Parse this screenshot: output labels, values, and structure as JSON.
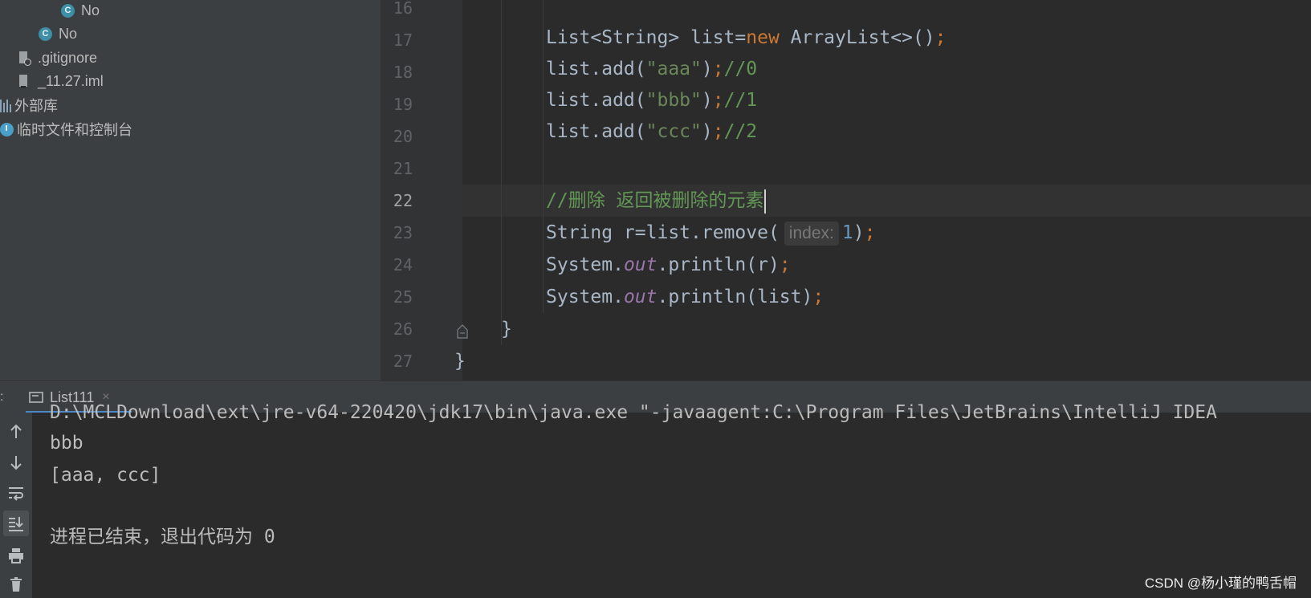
{
  "project_tree": {
    "items": [
      {
        "label": "No",
        "icon": "class-icon"
      },
      {
        "label": "No",
        "icon": "class-icon"
      },
      {
        "label": ".gitignore",
        "icon": "ignored-file-icon"
      },
      {
        "label": "_11.27.iml",
        "icon": "module-file-icon"
      },
      {
        "label": "外部库",
        "icon": "library-icon"
      },
      {
        "label": "临时文件和控制台",
        "icon": "scratch-icon"
      }
    ]
  },
  "editor": {
    "line_numbers": [
      "16",
      "17",
      "18",
      "19",
      "20",
      "21",
      "22",
      "23",
      "24",
      "25",
      "26",
      "27"
    ],
    "current_line": "22",
    "code": {
      "l17": {
        "t1": "List<String> list=",
        "kw_new": "new",
        "t2": " ArrayList<>()",
        "semi": ";"
      },
      "l18": {
        "t1": "list.add(",
        "str": "\"aaa\"",
        "t2": ")",
        "semi": ";",
        "comment": "//0"
      },
      "l19": {
        "t1": "list.add(",
        "str": "\"bbb\"",
        "t2": ")",
        "semi": ";",
        "comment": "//1"
      },
      "l20": {
        "t1": "list.add(",
        "str": "\"ccc\"",
        "t2": ")",
        "semi": ";",
        "comment": "//2"
      },
      "l22": {
        "comment": "//删除 返回被删除的元素"
      },
      "l23": {
        "t1": "String r=list.remove(",
        "hint_name": "index:",
        "hint_value": "1",
        "t2": ")",
        "semi": ";"
      },
      "l24": {
        "t1": "System.",
        "field": "out",
        "t2": ".println(r)",
        "semi": ";"
      },
      "l25": {
        "t1": "System.",
        "field": "out",
        "t2": ".println(list)",
        "semi": ";"
      },
      "l26": {
        "t1": "}"
      },
      "l27": {
        "t1": "}"
      }
    }
  },
  "run_panel": {
    "tab_prefix": ":",
    "tab_label": "List111",
    "tab_close": "×",
    "toolbar": [
      "up-arrow-icon",
      "down-arrow-icon",
      "soft-wrap-icon",
      "scroll-to-end-icon",
      "print-icon",
      "trash-icon"
    ],
    "console_lines": [
      "D:\\MCLDownload\\ext\\jre-v64-220420\\jdk17\\bin\\java.exe \"-javaagent:C:\\Program Files\\JetBrains\\IntelliJ IDEA",
      "bbb",
      "[aaa, ccc]",
      "",
      "进程已结束，退出代码为 0"
    ]
  },
  "watermark": "CSDN @杨小瑾的鸭舌帽",
  "colors": {
    "keyword": "#cc7832",
    "string": "#6a8759",
    "comment": "#629755",
    "number": "#6897bb",
    "field": "#9876aa",
    "accent": "#4a88c7"
  }
}
